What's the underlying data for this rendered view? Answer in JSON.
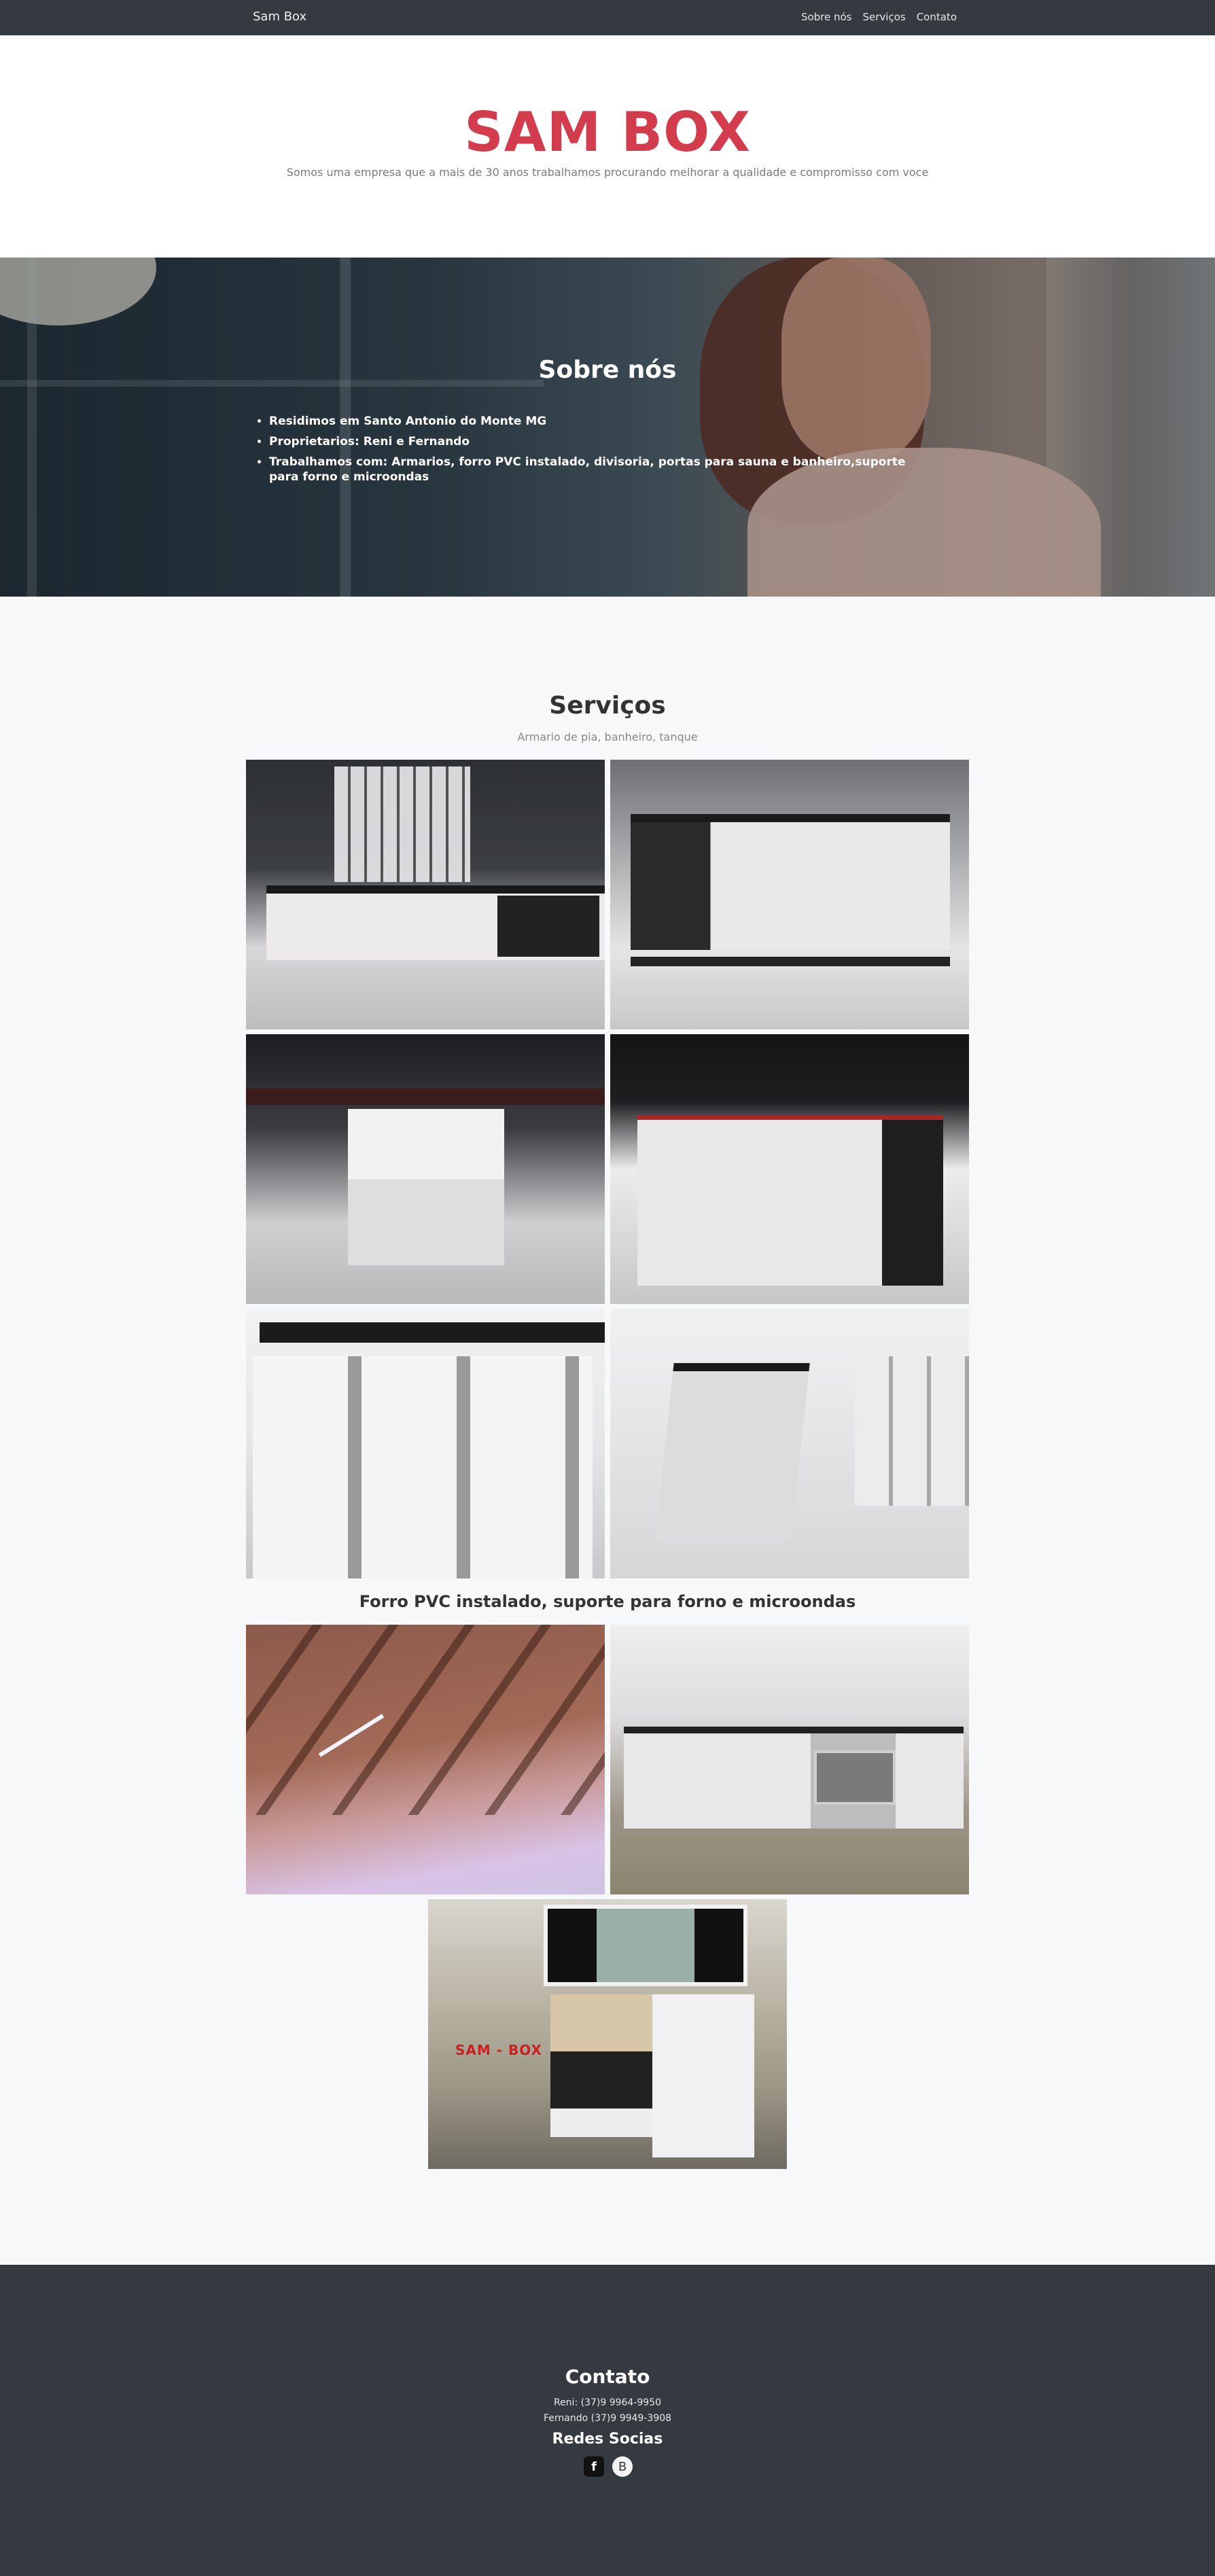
{
  "nav": {
    "brand": "Sam Box",
    "links": [
      "Sobre nós",
      "Serviços",
      "Contato"
    ]
  },
  "hero": {
    "title": "SAM BOX",
    "subtitle": "Somos uma empresa que a mais de 30 anos trabalhamos procurando melhorar a qualidade e compromisso com voce"
  },
  "about": {
    "title": "Sobre nós",
    "items": [
      "Residimos em Santo Antonio do Monte MG",
      "Proprietarios: Reni e Fernando",
      "Trabalhamos com: Armarios, forro PVC instalado, divisoria, portas para sauna e banheiro,suporte para forno e microondas"
    ]
  },
  "services": {
    "title": "Serviços",
    "subtitle": "Armario de pia, banheiro, tanque",
    "forro_title": "Forro PVC instalado, suporte para forno e microondas",
    "watermark": "SAM - BOX"
  },
  "footer": {
    "contact_title": "Contato",
    "phones": [
      "Reni: (37)9 9964-9950",
      "Fernando (37)9 9949-3908"
    ],
    "social_title": "Redes Socias",
    "social_icons": [
      "facebook-icon",
      "blogger-icon"
    ]
  },
  "colors": {
    "navbar": "#343a40",
    "accent": "#d23c4c",
    "page_bg": "#f7f8fa"
  }
}
